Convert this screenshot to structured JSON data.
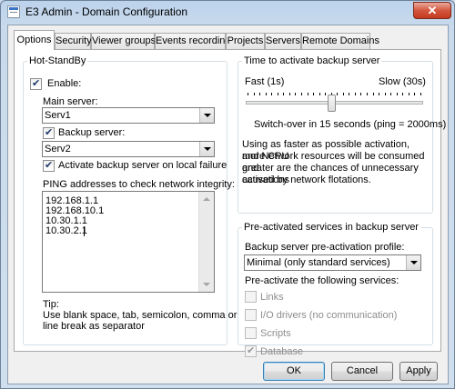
{
  "window": {
    "title": "E3 Admin - Domain Configuration",
    "close_glyph": "✕"
  },
  "tabs": [
    "Options",
    "Security",
    "Viewer groups",
    "Events recording",
    "Projects",
    "Servers",
    "Remote Domains"
  ],
  "active_tab": "Options",
  "hot_standby": {
    "title": "Hot-StandBy",
    "enable_label": "Enable:",
    "enable_checked": true,
    "main_server_label": "Main server:",
    "main_server_value": "Serv1",
    "backup_server_label": "Backup server:",
    "backup_server_checked": true,
    "backup_server_value": "Serv2",
    "activate_on_failure_label": "Activate backup server on local failure",
    "activate_on_failure_checked": true,
    "ping_label": "PING addresses to check network integrity:",
    "ping_addresses": [
      "192.168.1.1",
      "192.168.10.1",
      "10.30.1.1",
      "10.30.2.1"
    ],
    "tip_title": "Tip:",
    "tip_line1": "Use blank space, tab, semicolon, comma or",
    "tip_line2": "line break as separator"
  },
  "activation_time": {
    "title": "Time to activate backup server",
    "fast_label": "Fast (1s)",
    "slow_label": "Slow (30s)",
    "min_seconds": 1,
    "max_seconds": 30,
    "value_seconds": 15,
    "switchover_text": "Switch-over in 15 seconds (ping = 2000ms)",
    "info_line1": "Using as faster as possible activation, more CPU",
    "info_line2": "and Network resources will be consumed and",
    "info_line3": "greater are the chances of unnecessary activations",
    "info_line4": "caused by network flotations."
  },
  "preactivated": {
    "title": "Pre-activated services in backup server",
    "profile_label": "Backup server pre-activation profile:",
    "profile_value": "Minimal (only standard services)",
    "services_label": "Pre-activate the following services:",
    "services": [
      {
        "label": "Links",
        "checked": false
      },
      {
        "label": "I/O drivers (no communication)",
        "checked": false
      },
      {
        "label": "Scripts",
        "checked": false
      },
      {
        "label": "Database",
        "checked": true
      }
    ]
  },
  "buttons": {
    "ok": "OK",
    "cancel": "Cancel",
    "apply": "Apply"
  }
}
